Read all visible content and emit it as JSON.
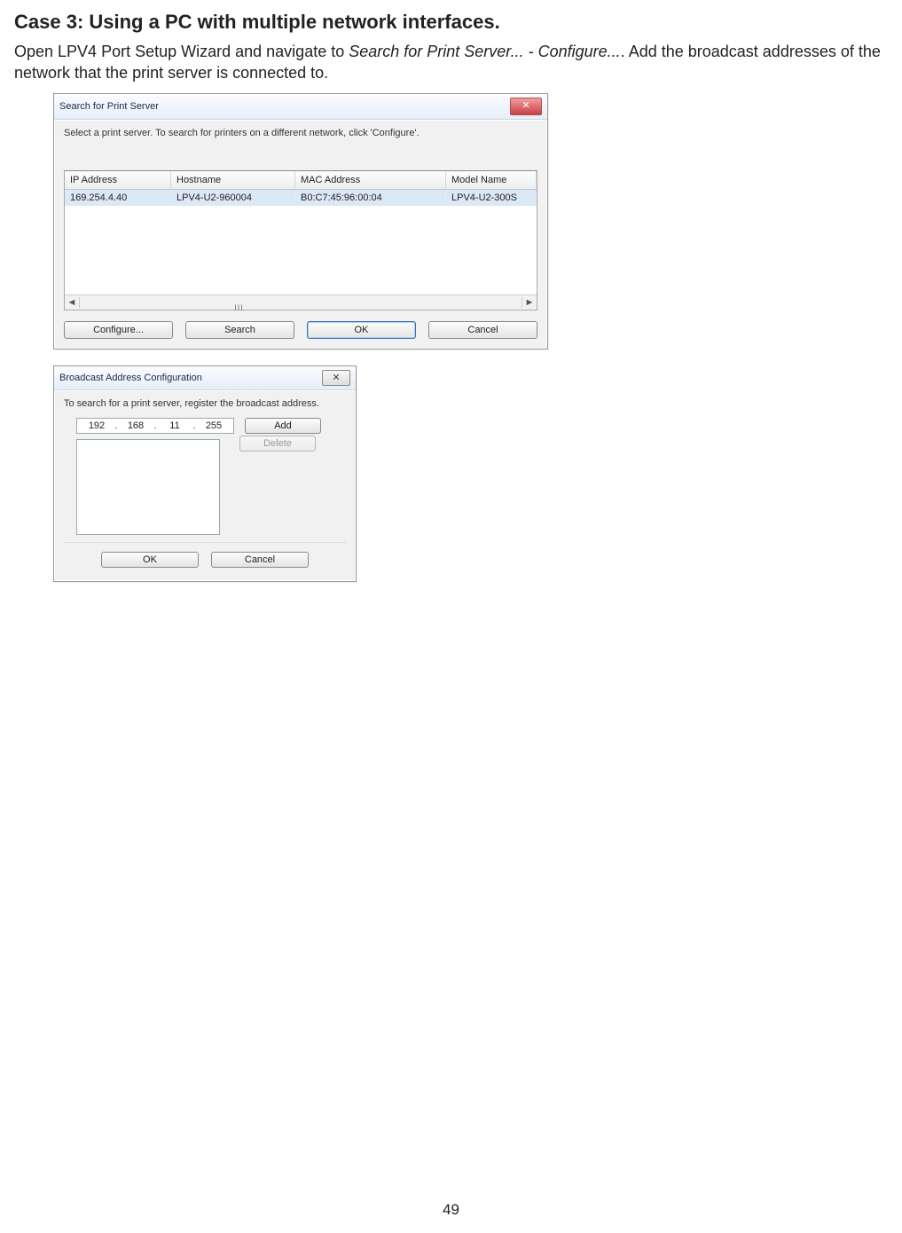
{
  "heading": "Case 3: Using a PC with multiple network interfaces.",
  "body_prefix": "Open LPV4 Port Setup Wizard and navigate to ",
  "body_italic": "Search for Print Server... - Configure...",
  "body_suffix": ". Add the broadcast addresses of the network that the print server is connected to.",
  "page_number": "49",
  "dialog1": {
    "title": "Search for Print Server",
    "instruction": "Select a print server. To search for printers on a different network, click 'Configure'.",
    "columns": {
      "ip": "IP Address",
      "host": "Hostname",
      "mac": "MAC Address",
      "model": "Model Name"
    },
    "row": {
      "ip": "169.254.4.40",
      "host": "LPV4-U2-960004",
      "mac": "B0:C7:45:96:00:04",
      "model": "LPV4-U2-300S"
    },
    "scroll_grip": "III",
    "buttons": {
      "configure": "Configure...",
      "search": "Search",
      "ok": "OK",
      "cancel": "Cancel"
    }
  },
  "dialog2": {
    "title": "Broadcast Address Configuration",
    "instruction": "To search for a print server, register the broadcast address.",
    "ip": {
      "a": "192",
      "b": "168",
      "c": "11",
      "d": "255"
    },
    "buttons": {
      "add": "Add",
      "delete": "Delete",
      "ok": "OK",
      "cancel": "Cancel"
    }
  }
}
